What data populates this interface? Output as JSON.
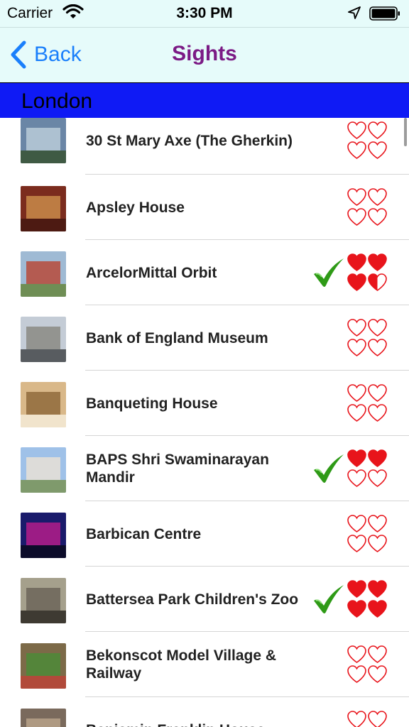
{
  "status_bar": {
    "carrier": "Carrier",
    "time": "3:30 PM"
  },
  "nav": {
    "back_label": "Back",
    "title": "Sights"
  },
  "section": {
    "title": "London"
  },
  "colors": {
    "nav_background": "#e6fbfa",
    "back_tint": "#1a7ffb",
    "title_purple": "#7b1a85",
    "section_blue": "#0f1af5",
    "heart_red": "#e8141b",
    "check_green": "#2e9a16"
  },
  "sights": [
    {
      "name": "30 St Mary Axe (The Gherkin)",
      "visited": false,
      "hearts_filled": 0,
      "thumb_colors": [
        "#6a86a6",
        "#b9cbd8",
        "#3f5a44"
      ]
    },
    {
      "name": "Apsley House",
      "visited": false,
      "hearts_filled": 0,
      "thumb_colors": [
        "#7b2c1e",
        "#c98b4a",
        "#4d1a12"
      ]
    },
    {
      "name": "ArcelorMittal Orbit",
      "visited": true,
      "hearts_filled": 3.5,
      "thumb_colors": [
        "#9fbad4",
        "#b74a3a",
        "#6f8e55"
      ]
    },
    {
      "name": "Bank of England Museum",
      "visited": false,
      "hearts_filled": 0,
      "thumb_colors": [
        "#c4ccd6",
        "#8b8a84",
        "#585c60"
      ]
    },
    {
      "name": "Banqueting House",
      "visited": false,
      "hearts_filled": 0,
      "thumb_colors": [
        "#d9b889",
        "#8f6a3c",
        "#f1e4cc"
      ]
    },
    {
      "name": "BAPS Shri Swaminarayan Mandir",
      "visited": true,
      "hearts_filled": 2,
      "thumb_colors": [
        "#9fc1e8",
        "#e8e1d6",
        "#7f9a6c"
      ]
    },
    {
      "name": "Barbican Centre",
      "visited": false,
      "hearts_filled": 0,
      "thumb_colors": [
        "#1a1b6b",
        "#b41c8a",
        "#0c0c2a"
      ]
    },
    {
      "name": "Battersea Park Children's Zoo",
      "visited": true,
      "hearts_filled": 4,
      "thumb_colors": [
        "#a5a08c",
        "#6c6559",
        "#3e3a32"
      ]
    },
    {
      "name": "Bekonscot Model Village & Railway",
      "visited": false,
      "hearts_filled": 0,
      "thumb_colors": [
        "#7c6a48",
        "#4e8a38",
        "#b14a3a"
      ]
    },
    {
      "name": "Benjamin Franklin House",
      "visited": false,
      "hearts_filled": 0,
      "thumb_colors": [
        "#7a6a5c",
        "#b8a288",
        "#4b3f35"
      ]
    }
  ]
}
